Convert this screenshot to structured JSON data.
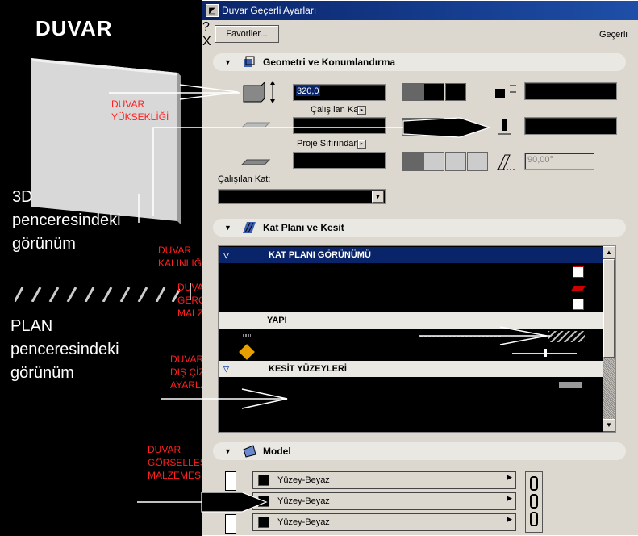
{
  "annotations": {
    "title": "DUVAR",
    "wall_height": [
      "DUVAR",
      "YÜKSEKLİĞİ"
    ],
    "view_3d": [
      "3D",
      "penceresindeki",
      "görünüm"
    ],
    "thickness": [
      "DUVAR",
      "KALINLIĞI"
    ],
    "material": [
      "DUVAR",
      "GERÇEK",
      "MALZEMESİ"
    ],
    "plan": [
      "PLAN",
      "penceresindeki",
      "görünüm"
    ],
    "outline": [
      "DUVAR",
      "DIŞ ÇİZGİ",
      "AYARLARI"
    ],
    "render": [
      "DUVAR",
      "GÖRSELLEŞTİRME",
      "MALZEMESİ"
    ]
  },
  "dialog": {
    "title": "Duvar Geçerli Ayarları",
    "help_button": "?",
    "close_button": "X",
    "favorites_button": "Favoriler...",
    "current_label": "Geçerli"
  },
  "geometry": {
    "section_title": "Geometri ve Konumlandırma",
    "height_value": "320,0",
    "working_story_label": "Çalışılan Kat",
    "project_zero_label": "Proje Sıfırından",
    "story_label": "Çalışılan Kat:",
    "angle_value": "90,00°"
  },
  "floorplan": {
    "section_title": "Kat Planı ve Kesit",
    "rows": {
      "plan_view": "KAT PLANI GÖRÜNÜMÜ",
      "structure": "YAPI",
      "section_surfaces": "KESİT YÜZEYLERİ"
    }
  },
  "model": {
    "section_title": "Model",
    "surfaces": [
      "Yüzey-Beyaz",
      "Yüzey-Beyaz",
      "Yüzey-Beyaz"
    ]
  },
  "colors": {
    "titlebar": "#0a246a",
    "annotation_red": "#ff2020",
    "dialog_bg": "#dcd8d0"
  }
}
